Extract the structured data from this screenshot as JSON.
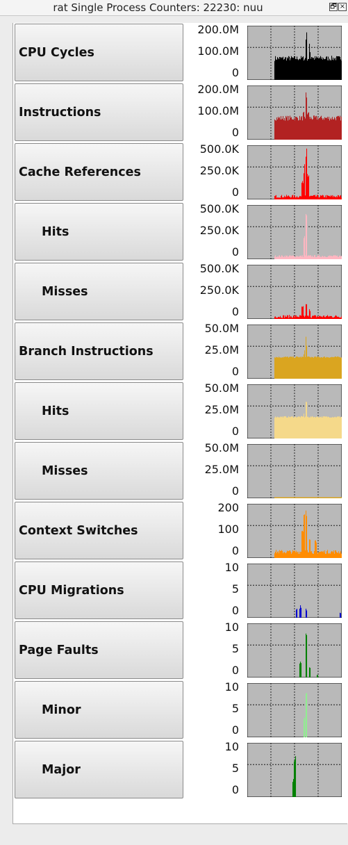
{
  "window": {
    "title": "rat Single Process Counters: 22230: nuu",
    "buttons": [
      {
        "name": "restore-button",
        "glyph": "🗗"
      },
      {
        "name": "close-button",
        "glyph": "×"
      }
    ]
  },
  "counters": [
    {
      "label": "CPU Cycles",
      "level": "main",
      "ticks": [
        "200.0M",
        "100.0M",
        "0"
      ],
      "color": "#000000"
    },
    {
      "label": "Instructions",
      "level": "main",
      "ticks": [
        "200.0M",
        "100.0M",
        "0"
      ],
      "color": "#b22222"
    },
    {
      "label": "Cache References",
      "level": "main",
      "ticks": [
        "500.0K",
        "250.0K",
        "0"
      ],
      "color": "#ff0000"
    },
    {
      "label": "Hits",
      "level": "sub",
      "ticks": [
        "500.0K",
        "250.0K",
        "0"
      ],
      "color": "#ffb6c1"
    },
    {
      "label": "Misses",
      "level": "sub",
      "ticks": [
        "500.0K",
        "250.0K",
        "0"
      ],
      "color": "#ff0000"
    },
    {
      "label": "Branch Instructions",
      "level": "main",
      "ticks": [
        "50.0M",
        "25.0M",
        "0"
      ],
      "color": "#daa520"
    },
    {
      "label": "Hits",
      "level": "sub",
      "ticks": [
        "50.0M",
        "25.0M",
        "0"
      ],
      "color": "#f5d98a"
    },
    {
      "label": "Misses",
      "level": "sub",
      "ticks": [
        "50.0M",
        "25.0M",
        "0"
      ],
      "color": "#daa520"
    },
    {
      "label": "Context Switches",
      "level": "main",
      "ticks": [
        "200",
        "100",
        "0"
      ],
      "color": "#ff8c00"
    },
    {
      "label": "CPU Migrations",
      "level": "main",
      "ticks": [
        "10",
        "5",
        "0"
      ],
      "color": "#0000cd"
    },
    {
      "label": "Page Faults",
      "level": "main",
      "ticks": [
        "10",
        "5",
        "0"
      ],
      "color": "#008000"
    },
    {
      "label": "Minor",
      "level": "sub",
      "ticks": [
        "10",
        "5",
        "0"
      ],
      "color": "#90ee90"
    },
    {
      "label": "Major",
      "level": "sub",
      "ticks": [
        "10",
        "5",
        "0"
      ],
      "color": "#008000"
    }
  ]
}
